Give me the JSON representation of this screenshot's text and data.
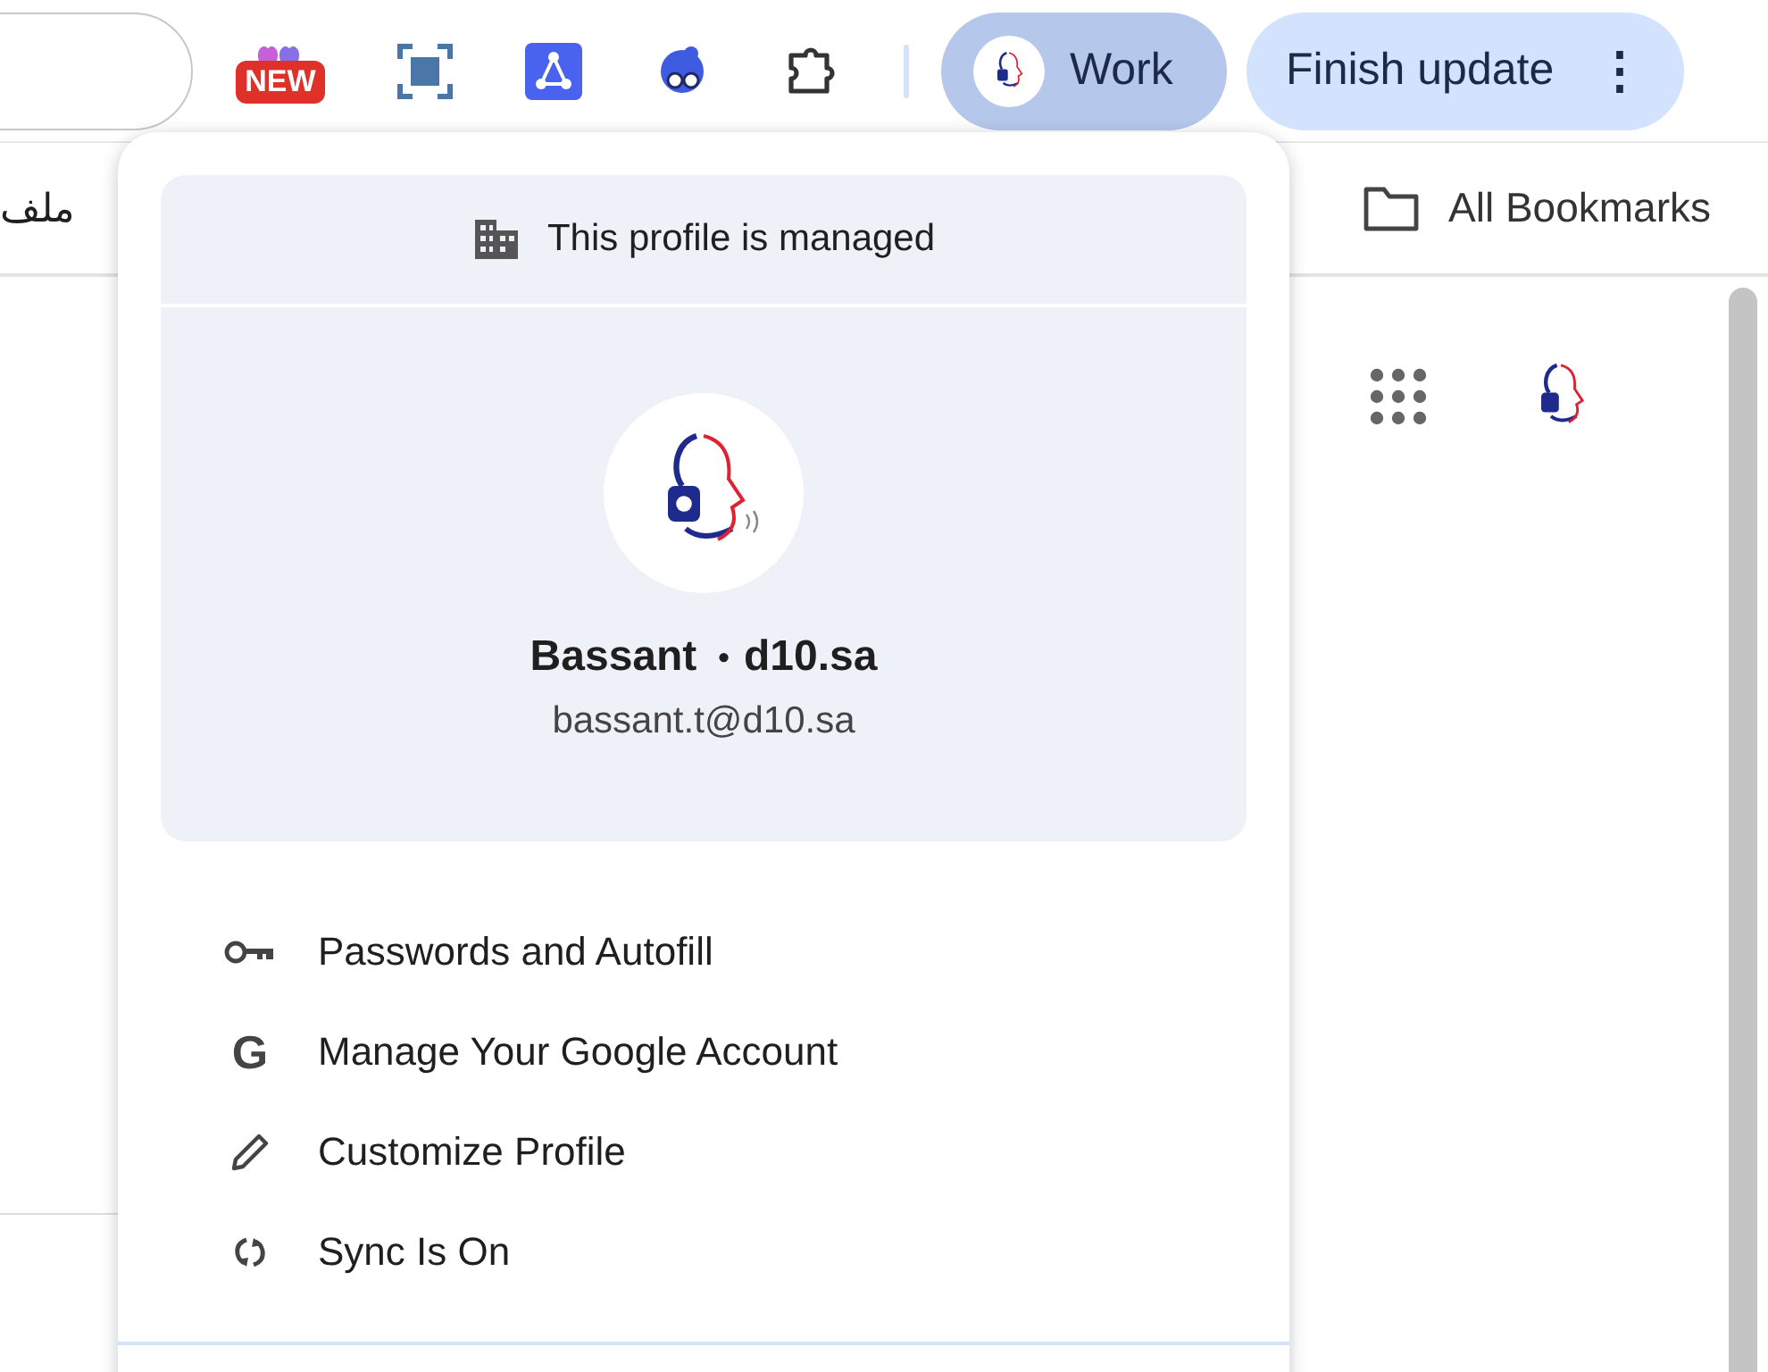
{
  "toolbar": {
    "extensions": [
      {
        "kind": "new-badge",
        "badge": "NEW"
      },
      {
        "kind": "screenshot"
      },
      {
        "kind": "graph"
      },
      {
        "kind": "reader"
      },
      {
        "kind": "puzzle"
      }
    ],
    "profile_chip": {
      "label": "Work",
      "selected": true
    },
    "update_button": {
      "label": "Finish update",
      "menu_glyph": "⋮"
    }
  },
  "bookmarks_bar": {
    "left_item": "ملف",
    "all_bookmarks": "All Bookmarks"
  },
  "profile_menu": {
    "managed_notice": "This profile is managed",
    "name": "Bassant",
    "separator": "•",
    "domain": "d10.sa",
    "email": "bassant.t@d10.sa",
    "items": [
      {
        "kind": "key",
        "label": "Passwords and Autofill"
      },
      {
        "kind": "google",
        "glyph": "G",
        "label": "Manage Your Google Account"
      },
      {
        "kind": "pencil",
        "label": "Customize Profile"
      },
      {
        "kind": "sync",
        "label": "Sync Is On"
      }
    ]
  }
}
